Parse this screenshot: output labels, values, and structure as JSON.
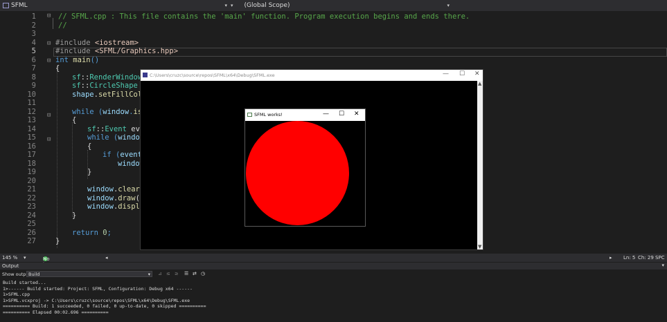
{
  "topbar": {
    "file_label": "SFML",
    "scope_label": "(Global Scope)"
  },
  "editor": {
    "lines": [
      {
        "n": "1",
        "text": "// SFML.cpp : This file contains the 'main' function. Program execution begins and ends there."
      },
      {
        "n": "2",
        "text": "//"
      },
      {
        "n": "3",
        "text": ""
      },
      {
        "n": "4",
        "text": "#include <iostream>"
      },
      {
        "n": "5",
        "text": "#include <SFML/Graphics.hpp>"
      },
      {
        "n": "6",
        "text": "int main()"
      },
      {
        "n": "7",
        "text": "{"
      },
      {
        "n": "8",
        "text": "sf::RenderWindow w"
      },
      {
        "n": "9",
        "text": "sf::CircleShape sh"
      },
      {
        "n": "10",
        "text": "shape.setFillColo"
      },
      {
        "n": "11",
        "text": ""
      },
      {
        "n": "12",
        "text": "while (window.isOp"
      },
      {
        "n": "13",
        "text": "{"
      },
      {
        "n": "14",
        "text": "sf::Event even"
      },
      {
        "n": "15",
        "text": "while (window."
      },
      {
        "n": "16",
        "text": "{"
      },
      {
        "n": "17",
        "text": "if (event."
      },
      {
        "n": "18",
        "text": "window"
      },
      {
        "n": "19",
        "text": "}"
      },
      {
        "n": "20",
        "text": ""
      },
      {
        "n": "21",
        "text": "window.clear()"
      },
      {
        "n": "22",
        "text": "window.draw(sh"
      },
      {
        "n": "23",
        "text": "window.display"
      },
      {
        "n": "24",
        "text": "}"
      },
      {
        "n": "25",
        "text": ""
      },
      {
        "n": "26",
        "text": "return 0;"
      },
      {
        "n": "27",
        "text": "}"
      }
    ],
    "current_line": "5"
  },
  "editor_status": {
    "zoom": "145 %",
    "issues": "No issues found",
    "ln": "Ln: 5",
    "ch": "Ch: 29",
    "mode": "SPC"
  },
  "output": {
    "title": "Output",
    "show_from_label": "Show output from:",
    "source": "Build",
    "lines": [
      "Build started...",
      "1>------ Build started: Project: SFML, Configuration: Debug x64 ------",
      "1>SFML.cpp",
      "1>SFML.vcxproj -> C:\\Users\\cruzc\\source\\repos\\SFML\\x64\\Debug\\SFML.exe",
      "========== Build: 1 succeeded, 0 failed, 0 up-to-date, 0 skipped ==========",
      "========== Elapsed 00:02.696 =========="
    ]
  },
  "console_window": {
    "title": "C:\\Users\\cruzc\\source\\repos\\SFML\\x64\\Debug\\SFML.exe"
  },
  "sfml_window": {
    "title": "SFML works!",
    "shape_color": "#ff0000"
  },
  "colors": {
    "editor_bg": "#1e1e1e",
    "comment": "#57a64a",
    "keyword": "#569cd6",
    "type": "#4ec9b0"
  }
}
